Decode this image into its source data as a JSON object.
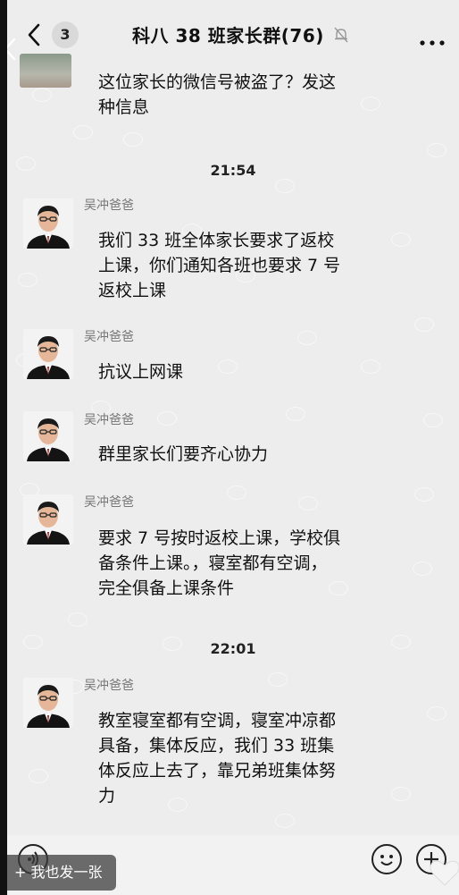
{
  "header": {
    "back_count": "3",
    "title": "科八 38 班家长群(76)"
  },
  "messages": [
    {
      "type": "text_continued",
      "text": "这位家长的微信号被盗了？发这种信息"
    },
    {
      "type": "time",
      "text": "21:54"
    },
    {
      "type": "text",
      "sender": "吴冲爸爸",
      "text": "我们 33 班全体家长要求了返校上课，你们通知各班也要求 7 号返校上课"
    },
    {
      "type": "text",
      "sender": "吴冲爸爸",
      "text": "抗议上网课"
    },
    {
      "type": "text",
      "sender": "吴冲爸爸",
      "text": "群里家长们要齐心协力"
    },
    {
      "type": "text",
      "sender": "吴冲爸爸",
      "text": "要求 7 号按时返校上课，学校俱备条件上课。，寝室都有空调，完全俱备上课条件"
    },
    {
      "type": "time",
      "text": "22:01"
    },
    {
      "type": "text",
      "sender": "吴冲爸爸",
      "text": "教室寝室都有空调，寝室冲凉都具备，集体反应，我们 33 班集体反应上去了，靠兄弟班集体努力"
    }
  ],
  "lines": {
    "m0": [
      "这位家长的微信号被盗了？发这",
      "种信息"
    ],
    "m2": [
      "我们 33 班全体家长要求了返校",
      "上课，你们通知各班也要求 7 号",
      "返校上课"
    ],
    "m5": [
      "要求 7 号按时返校上课，学校俱",
      "备条件上课。，寝室都有空调，",
      "完全俱备上课条件"
    ],
    "m7": [
      "教室寝室都有空调，寝室冲凉都",
      "具备，集体反应，我们 33 班集",
      "体反应上去了，靠兄弟班集体努",
      "力"
    ]
  },
  "bottom": {
    "share_label": "+ 我也发一张"
  },
  "icons": {
    "back": "chevron-left-icon",
    "mute": "bell-muted-icon",
    "more": "more-dots-icon",
    "voice": "voice-icon",
    "emoji": "emoji-icon",
    "plus": "plus-icon",
    "heart": "heart-icon"
  }
}
